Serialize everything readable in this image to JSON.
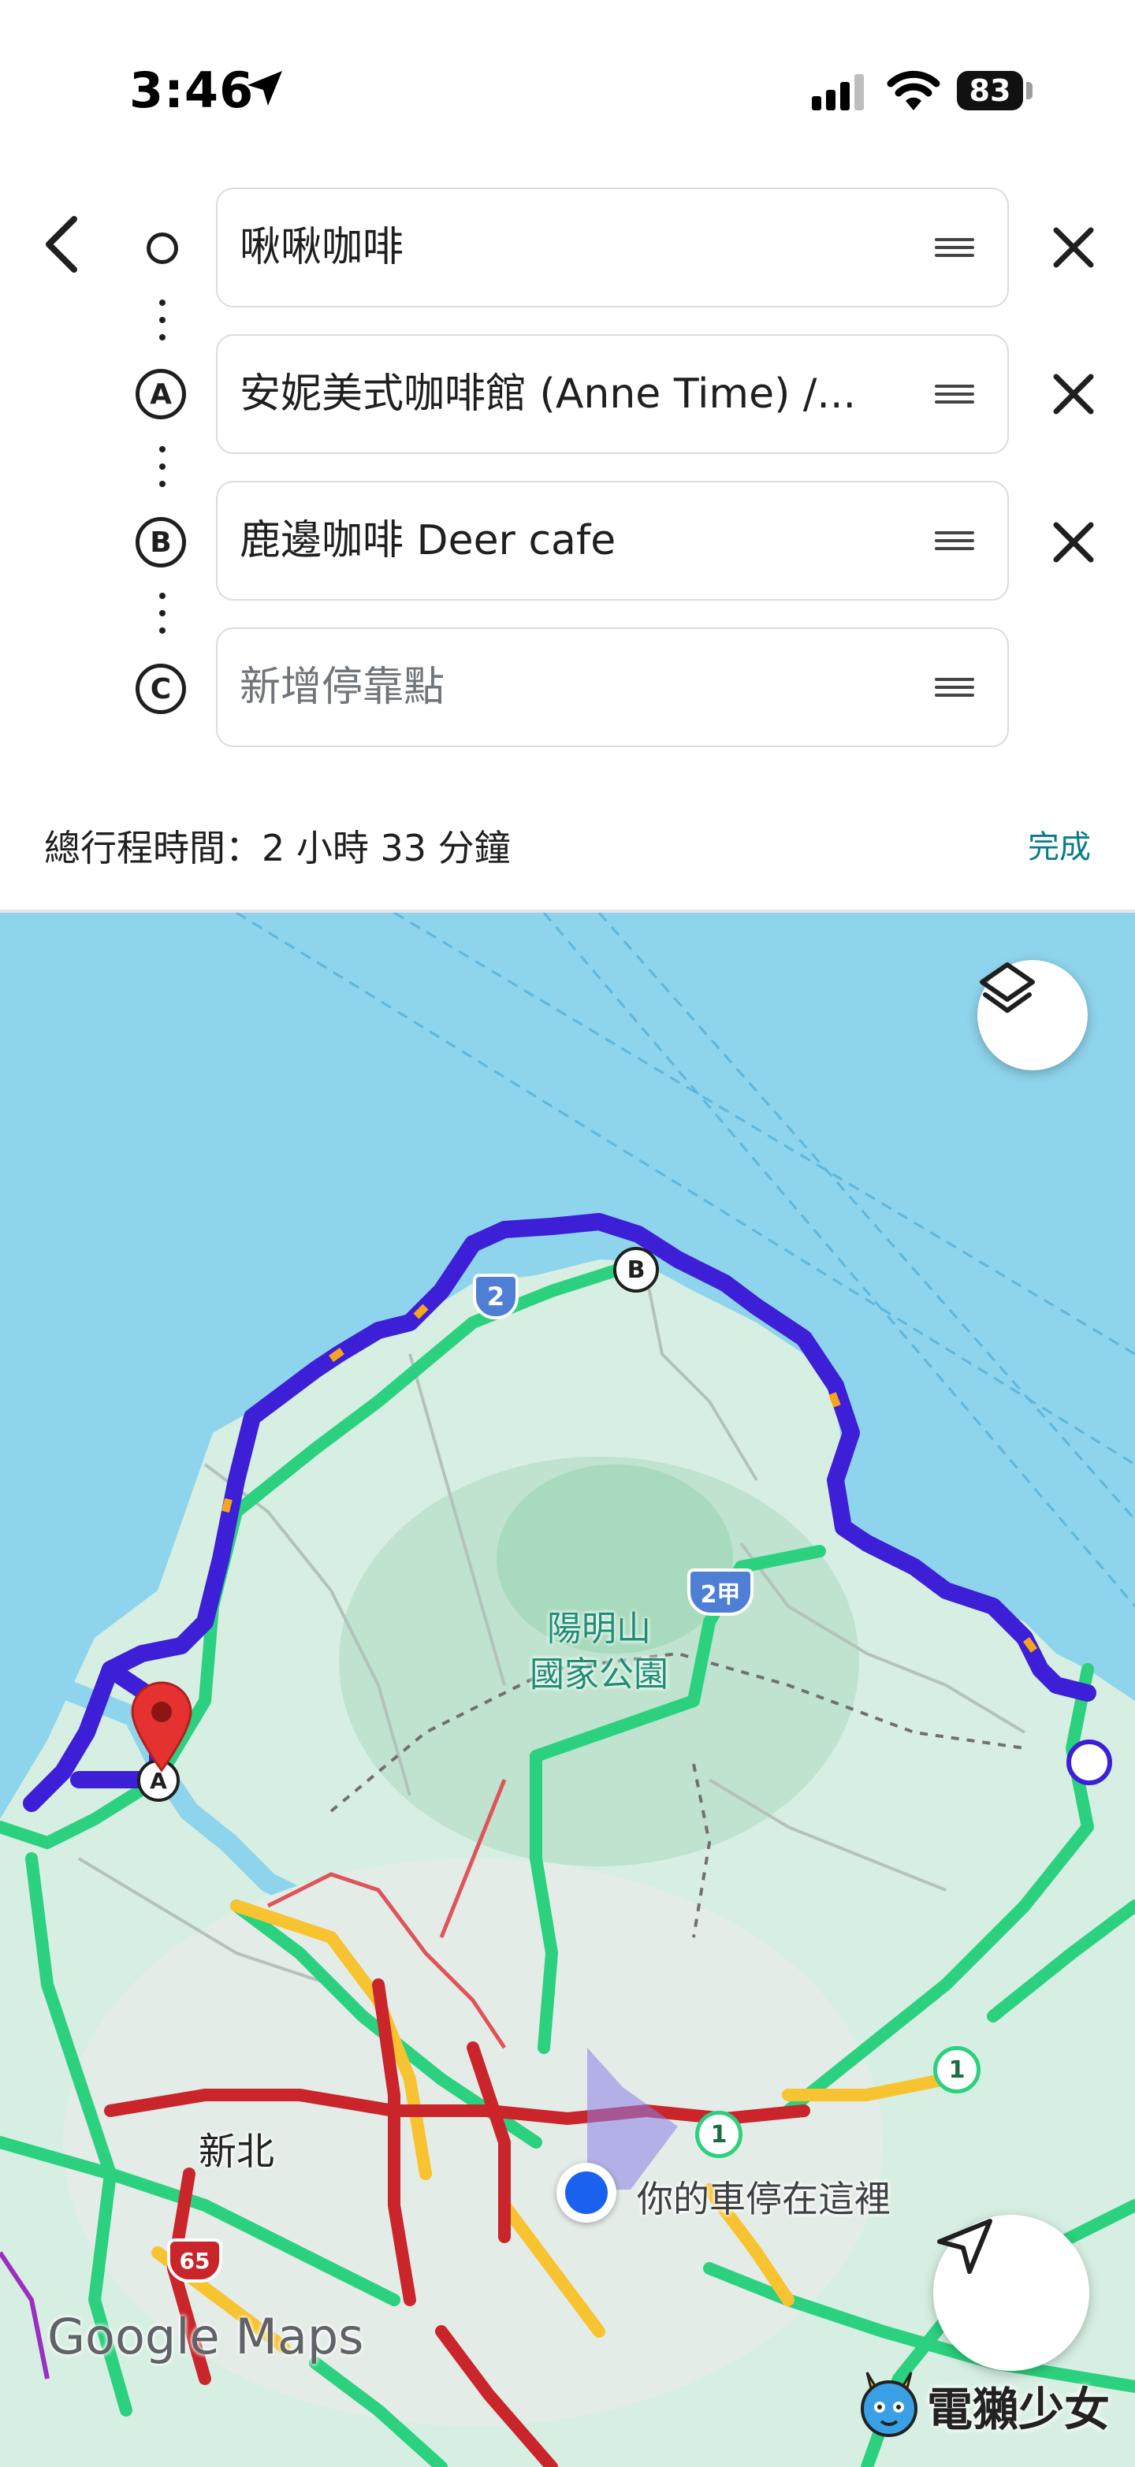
{
  "status_bar": {
    "time": "3:46",
    "battery": "83"
  },
  "route": {
    "stops": [
      {
        "marker": "",
        "value": "啾啾咖啡",
        "placeholder": ""
      },
      {
        "marker": "A",
        "value": "安妮美式咖啡館 (Anne Time) /...",
        "placeholder": ""
      },
      {
        "marker": "B",
        "value": "鹿邊咖啡 Deer cafe",
        "placeholder": ""
      },
      {
        "marker": "C",
        "value": "",
        "placeholder": "新增停靠點"
      }
    ],
    "total_time": "總行程時間：2 小時 33 分鐘",
    "done_label": "完成"
  },
  "map": {
    "park_label": "陽明山\n國家公園",
    "park_line1": "陽明山",
    "park_line2": "國家公園",
    "city_label": "新北",
    "car_label": "你的車停在這裡",
    "route_markers": {
      "a": "A",
      "b": "B"
    },
    "road_shields": [
      "2",
      "2甲",
      "1",
      "1",
      "65"
    ],
    "logo": "Google Maps",
    "watermark": "電獺少女",
    "colors": {
      "route": "#3c1fd6",
      "water": "#8ed4ec",
      "land": "#d7efe2",
      "park": "#bfe3cf",
      "traffic_green": "#2bd17e",
      "traffic_yellow": "#f7c331",
      "traffic_red": "#c9252b",
      "location": "#1a61f0"
    }
  }
}
